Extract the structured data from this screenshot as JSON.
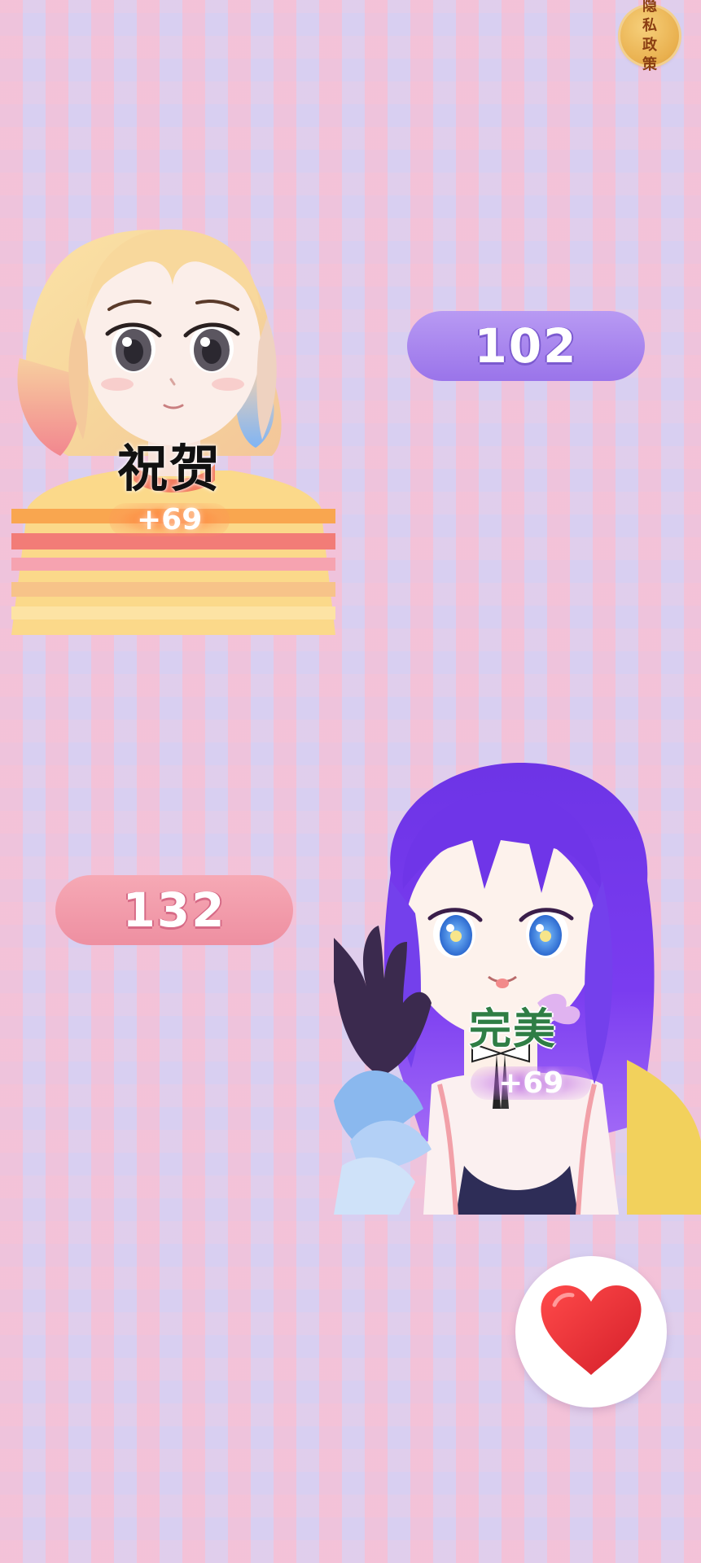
{
  "privacy": {
    "label": "隐私政策"
  },
  "players": {
    "left": {
      "reaction": "祝贺",
      "points": "+69"
    },
    "right": {
      "reaction": "完美",
      "points": "+69"
    }
  },
  "scores": {
    "top": "102",
    "bottom": "132"
  },
  "like": {
    "icon": "heart-icon"
  },
  "colors": {
    "score_top_bg": "#9a74ea",
    "score_bottom_bg": "#ee8fa1",
    "heart": "#e5252e",
    "privacy_badge": "#e9b04e"
  }
}
